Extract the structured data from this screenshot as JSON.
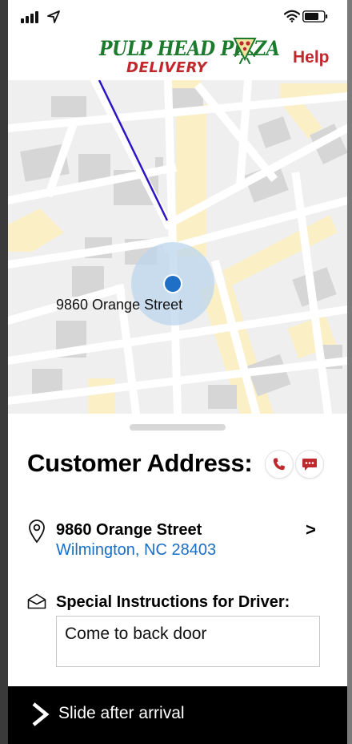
{
  "status_bar": {
    "icons": [
      "signal-icon",
      "location-arrow-icon",
      "wifi-icon",
      "battery-icon"
    ]
  },
  "header": {
    "brand_name": "PULP HEAD PIZZA",
    "brand_sub": "DELIVERY",
    "help_label": "Help",
    "brand_colors": {
      "green": "#1b7a2c",
      "red": "#c0282d"
    }
  },
  "map": {
    "location_label": "9860 Orange Street",
    "route_color": "#2a14c8",
    "pin_color": "#1f6fc6"
  },
  "sheet": {
    "title": "Customer Address:",
    "call_icon": "phone-icon",
    "message_icon": "chat-icon",
    "address": {
      "line1": "9860 Orange Street",
      "line2": "Wilmington, NC 28403",
      "chevron": ">"
    },
    "instructions": {
      "label": "Special Instructions for Driver:",
      "value": "Come to back door"
    }
  },
  "slide": {
    "label": "Slide after arrival"
  }
}
